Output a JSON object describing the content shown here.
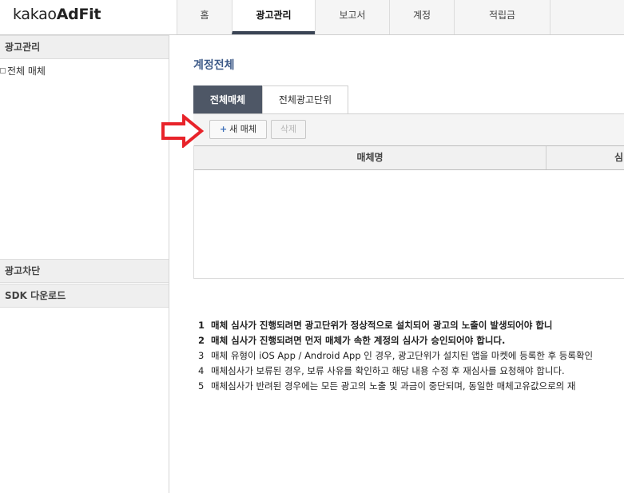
{
  "logo": {
    "prefix": "kakao",
    "brand": "AdFit"
  },
  "nav": [
    {
      "label": "홈",
      "active": false
    },
    {
      "label": "광고관리",
      "active": true
    },
    {
      "label": "보고서",
      "active": false
    },
    {
      "label": "계정",
      "active": false
    },
    {
      "label": "적립금",
      "active": false
    }
  ],
  "sidebar": {
    "ad_management": "광고관리",
    "tree_item": "전체 매체",
    "ad_block": "광고차단",
    "sdk_download": "SDK 다운로드"
  },
  "main": {
    "title": "계정전체",
    "tabs": [
      {
        "label": "전체매체",
        "active": true
      },
      {
        "label": "전체광고단위",
        "active": false
      }
    ],
    "buttons": {
      "new_media_icon": "+",
      "new_media": "새 매체",
      "delete": "삭제"
    },
    "table": {
      "headers": [
        "매체명",
        "심"
      ]
    }
  },
  "notes": [
    {
      "num": "1",
      "text": "매체 심사가 진행되려면 광고단위가 정상적으로 설치되어 광고의 노출이 발생되어야 합니",
      "bold": true
    },
    {
      "num": "2",
      "text": "매체 심사가 진행되려면 먼저 매체가 속한 계정의 심사가 승인되어야 합니다.",
      "bold": true
    },
    {
      "num": "3",
      "text": "매체 유형이 iOS App / Android App 인 경우, 광고단위가 설치된 앱을 마켓에 등록한 후 등록확인",
      "bold": false
    },
    {
      "num": "4",
      "text": "매체심사가 보류된 경우, 보류 사유를 확인하고 해당 내용 수정 후 재심사를 요청해야 합니다.",
      "bold": false
    },
    {
      "num": "5",
      "text": "매체심사가 반려된 경우에는 모든 광고의 노출 및 과금이 중단되며, 동일한 매체고유값으로의 재",
      "bold": false
    }
  ],
  "colors": {
    "accent_tab": "#4e5766",
    "title_blue": "#3d5a88",
    "arrow_red": "#e8232a"
  },
  "icons": {
    "arrow": "arrow-right-icon",
    "tree": "tree-node-icon",
    "plus": "plus-icon"
  }
}
